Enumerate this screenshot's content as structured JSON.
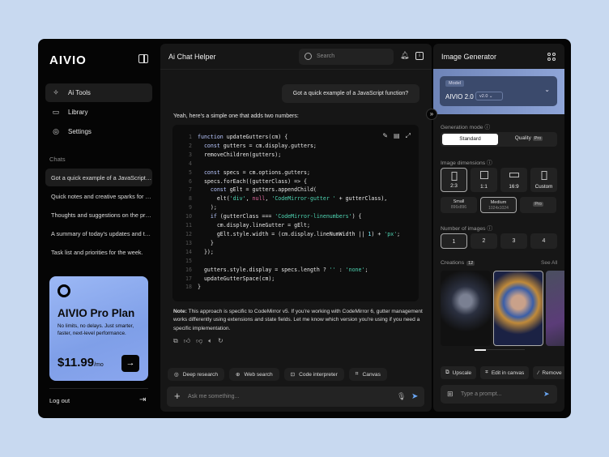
{
  "sidebar": {
    "logo": "AIVIO",
    "nav": [
      {
        "label": "Ai Tools",
        "icon": "sparkles-icon"
      },
      {
        "label": "Library",
        "icon": "folder-icon"
      },
      {
        "label": "Settings",
        "icon": "gear-icon"
      }
    ],
    "chats_heading": "Chats",
    "chats": [
      "Got a quick example of a JavaScript function?",
      "Quick notes and creative sparks for today",
      "Thoughts and suggestions on the project",
      "A summary of today's updates and tasks",
      "Task list and priorities for the week."
    ],
    "promo": {
      "title": "AIVIO Pro Plan",
      "desc": "No limits, no delays. Just smarter, faster, next-level performance.",
      "price": "$11.99",
      "period": "/mo"
    },
    "logout": "Log out"
  },
  "chat": {
    "title": "Ai Chat Helper",
    "search_placeholder": "Search",
    "user_message": "Got a quick example of a JavaScript function?",
    "ai_intro": "Yeah, here's a simple one that adds two numbers:",
    "code": [
      [
        [
          "function ",
          "k"
        ],
        [
          "updateGutters(cm) {",
          ""
        ]
      ],
      [
        [
          "  const ",
          "k"
        ],
        [
          "gutters = cm.display.gutters;",
          ""
        ]
      ],
      [
        [
          "  removeChildren(gutters);",
          ""
        ]
      ],
      [
        [
          "",
          ""
        ]
      ],
      [
        [
          "  const ",
          "k"
        ],
        [
          "specs = cm.options.gutters;",
          ""
        ]
      ],
      [
        [
          "  specs.forEach((gutterClass) => {",
          ""
        ]
      ],
      [
        [
          "    const ",
          "k"
        ],
        [
          "gElt = gutters.appendChild(",
          ""
        ]
      ],
      [
        [
          "      elt(",
          ""
        ],
        [
          "'div'",
          "s"
        ],
        [
          ", ",
          ""
        ],
        [
          "null",
          "n"
        ],
        [
          ", ",
          ""
        ],
        [
          "'CodeMirror-gutter '",
          "s"
        ],
        [
          " + gutterClass),",
          ""
        ]
      ],
      [
        [
          "    );",
          ""
        ]
      ],
      [
        [
          "    if ",
          "k"
        ],
        [
          "(gutterClass === ",
          ""
        ],
        [
          "'CodeMirror-linenumbers'",
          "s"
        ],
        [
          ") {",
          ""
        ]
      ],
      [
        [
          "      cm.display.lineGutter = gElt;",
          ""
        ]
      ],
      [
        [
          "      gElt.style.width = (cm.display.lineNumWidth || ",
          ""
        ],
        [
          "1",
          "num"
        ],
        [
          ") + ",
          ""
        ],
        [
          "'px'",
          "s"
        ],
        [
          ";",
          ""
        ]
      ],
      [
        [
          "    }",
          ""
        ]
      ],
      [
        [
          "  });",
          ""
        ]
      ],
      [
        [
          "",
          ""
        ]
      ],
      [
        [
          "  gutters.style.display = specs.length ? ",
          ""
        ],
        [
          "''",
          "s"
        ],
        [
          " : ",
          ""
        ],
        [
          "'none'",
          "s"
        ],
        [
          ";",
          ""
        ]
      ],
      [
        [
          "  updateGutterSpace(cm);",
          ""
        ]
      ],
      [
        [
          "}",
          ""
        ]
      ]
    ],
    "note_label": "Note:",
    "note": " This approach is specific to CodeMirror v5. If you're working with CodeMirror 6, gutter management works differently using extensions and state fields. Let me know which version you're using if you need a specific implementation.",
    "tools": [
      "Deep research",
      "Web search",
      "Code interpreter",
      "Canvas"
    ],
    "input_placeholder": "Ask me something..."
  },
  "generator": {
    "title": "Image Generator",
    "model_label": "Model",
    "model_name": "AIVIO 2.0",
    "model_version": "v2.0",
    "mode_heading": "Generation mode",
    "modes": [
      "Standard",
      "Quality"
    ],
    "pro": "Pro",
    "dims_heading": "Image dimensions",
    "dims": [
      "2:3",
      "1:1",
      "16:9",
      "Custom"
    ],
    "sizes": [
      {
        "name": "Small",
        "res": "896x896"
      },
      {
        "name": "Medium",
        "res": "1024x1024"
      }
    ],
    "num_heading": "Number of images",
    "nums": [
      "1",
      "2",
      "3",
      "4"
    ],
    "creations": "Creations",
    "creations_count": "12",
    "see_all": "See All",
    "actions": [
      "Upscale",
      "Edit in canvas",
      "Remove"
    ],
    "prompt_placeholder": "Type a prompt..."
  }
}
